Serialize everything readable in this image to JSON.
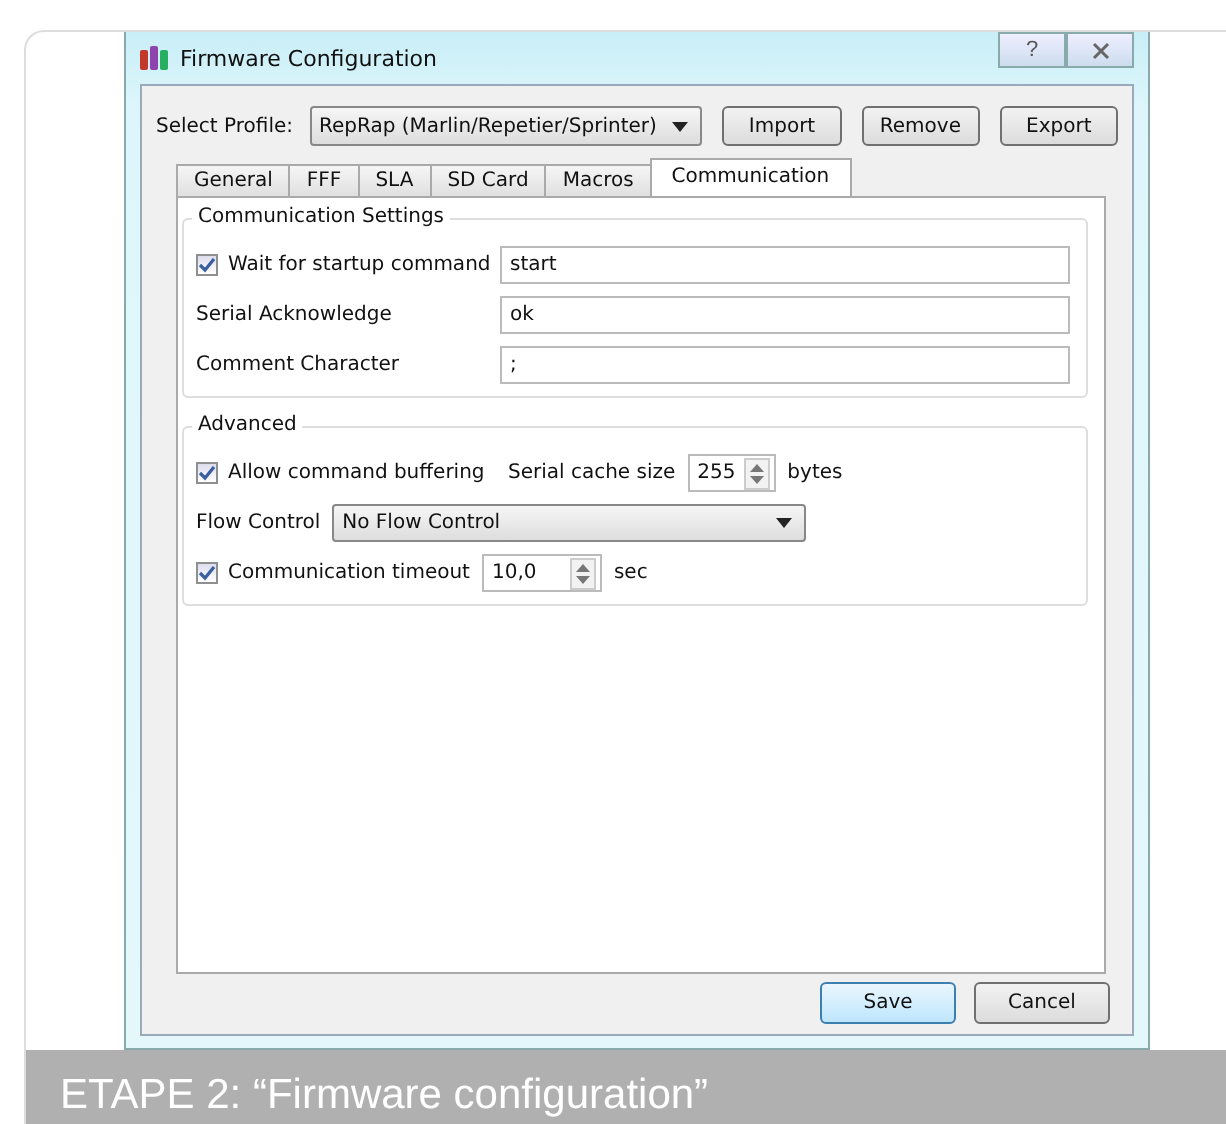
{
  "window": {
    "title": "Firmware Configuration",
    "help": "?"
  },
  "profile": {
    "label": "Select Profile:",
    "value": "RepRap (Marlin/Repetier/Sprinter)"
  },
  "profile_buttons": [
    "Import",
    "Remove",
    "Export"
  ],
  "tabs": [
    {
      "label": "General",
      "selected": false
    },
    {
      "label": "FFF",
      "selected": false
    },
    {
      "label": "SLA",
      "selected": false
    },
    {
      "label": "SD Card",
      "selected": false
    },
    {
      "label": "Macros",
      "selected": false
    },
    {
      "label": "Communication",
      "selected": true
    }
  ],
  "communication_settings": {
    "title": "Communication Settings",
    "rows": [
      {
        "kind": "checkbox",
        "label": "Wait for startup command",
        "checked": true,
        "value": "start"
      },
      {
        "kind": "label",
        "label": "Serial Acknowledge",
        "value": "ok"
      },
      {
        "kind": "label",
        "label": "Comment Character",
        "value": ";"
      }
    ]
  },
  "advanced": {
    "title": "Advanced",
    "buffering": {
      "label": "Allow command buffering",
      "checked": true
    },
    "cache": {
      "label": "Serial cache size",
      "value": "255",
      "unit": "bytes"
    },
    "flow": {
      "label": "Flow Control",
      "value": "No Flow Control"
    },
    "timeout": {
      "label": "Communication timeout",
      "checked": true,
      "value": "10,0",
      "unit": "sec"
    }
  },
  "footer_buttons": [
    {
      "label": "Save",
      "focused": true
    },
    {
      "label": "Cancel",
      "focused": false
    }
  ],
  "caption": "ETAPE 2: “Firmware configuration”"
}
